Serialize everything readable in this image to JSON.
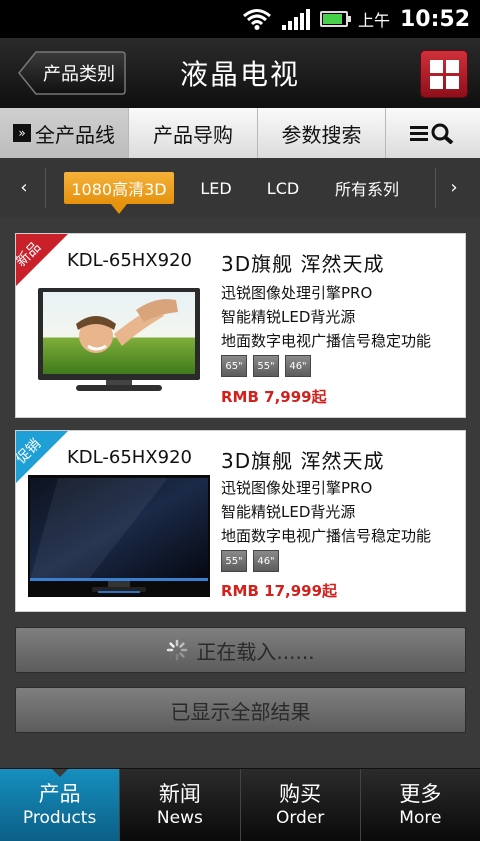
{
  "status_bar": {
    "ampm": "上午",
    "time": "10:52"
  },
  "header": {
    "back_label": "产品类别",
    "title": "液晶电视",
    "grid_icon": "grid-icon"
  },
  "top_tabs": [
    {
      "label": "全产品线",
      "active": true
    },
    {
      "label": "产品导购",
      "active": false
    },
    {
      "label": "参数搜索",
      "active": false
    },
    {
      "label": "",
      "icon": "list-search-icon",
      "active": false
    }
  ],
  "filters": {
    "items": [
      "1080高清3D",
      "LED",
      "LCD",
      "所有系列"
    ],
    "active_index": 0
  },
  "products": [
    {
      "badge": "新品",
      "badge_color": "#c9202a",
      "model": "KDL-65HX920",
      "headline": "3D旗舰  浑然天成",
      "features": [
        "迅锐图像处理引擎PRO",
        "智能精锐LED背光源",
        "地面数字电视广播信号稳定功能"
      ],
      "sizes": [
        "65\"",
        "55\"",
        "46\""
      ],
      "price": "RMB 7,999起"
    },
    {
      "badge": "促销",
      "badge_color": "#1e9fd6",
      "model": "KDL-65HX920",
      "headline": "3D旗舰  浑然天成",
      "features": [
        "迅锐图像处理引擎PRO",
        "智能精锐LED背光源",
        "地面数字电视广播信号稳定功能"
      ],
      "sizes": [
        "55\"",
        "46\""
      ],
      "price": "RMB 17,999起"
    }
  ],
  "loading_label": "正在载入......",
  "all_shown_label": "已显示全部结果",
  "bottom_nav": [
    {
      "cn": "产品",
      "en": "Products",
      "active": true
    },
    {
      "cn": "新闻",
      "en": "News",
      "active": false
    },
    {
      "cn": "购买",
      "en": "Order",
      "active": false
    },
    {
      "cn": "更多",
      "en": "More",
      "active": false
    }
  ]
}
